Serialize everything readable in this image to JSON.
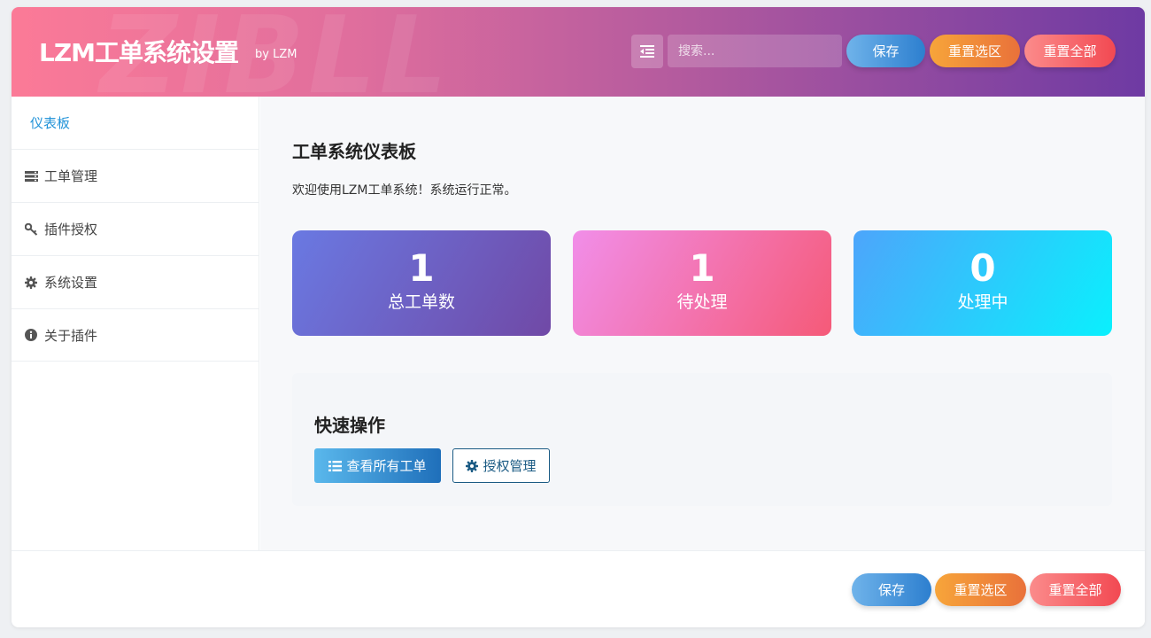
{
  "header": {
    "watermark": "ZIBLL",
    "title": "LZM工单系统设置",
    "byline": "by LZM",
    "toggle_icon": "indent-menu-icon",
    "search_placeholder": "搜索...",
    "save_label": "保存",
    "reset_section_label": "重置选区",
    "reset_all_label": "重置全部"
  },
  "sidebar": {
    "breadcrumb": "仪表板",
    "items": [
      {
        "label": "工单管理",
        "icon": "server-icon"
      },
      {
        "label": "插件授权",
        "icon": "key-icon"
      },
      {
        "label": "系统设置",
        "icon": "gear-icon"
      },
      {
        "label": "关于插件",
        "icon": "info-circle-icon"
      }
    ]
  },
  "main": {
    "title": "工单系统仪表板",
    "welcome": "欢迎使用LZM工单系统！系统运行正常。",
    "stats": [
      {
        "value": "1",
        "label": "总工单数",
        "colors": [
          "#6a79e2",
          "#7049a6"
        ]
      },
      {
        "value": "1",
        "label": "待处理",
        "colors": [
          "#f18ee9",
          "#f55a78"
        ]
      },
      {
        "value": "0",
        "label": "处理中",
        "colors": [
          "#4da5fb",
          "#0af0fd"
        ]
      }
    ],
    "quick": {
      "title": "快速操作",
      "view_all_label": "查看所有工单",
      "license_label": "授权管理"
    }
  },
  "footer": {
    "save_label": "保存",
    "reset_section_label": "重置选区",
    "reset_all_label": "重置全部"
  },
  "colors": {
    "accent_blue": "#2293d8",
    "header_gradient_start": "#fb7a97",
    "header_gradient_end": "#6e3aa3"
  }
}
